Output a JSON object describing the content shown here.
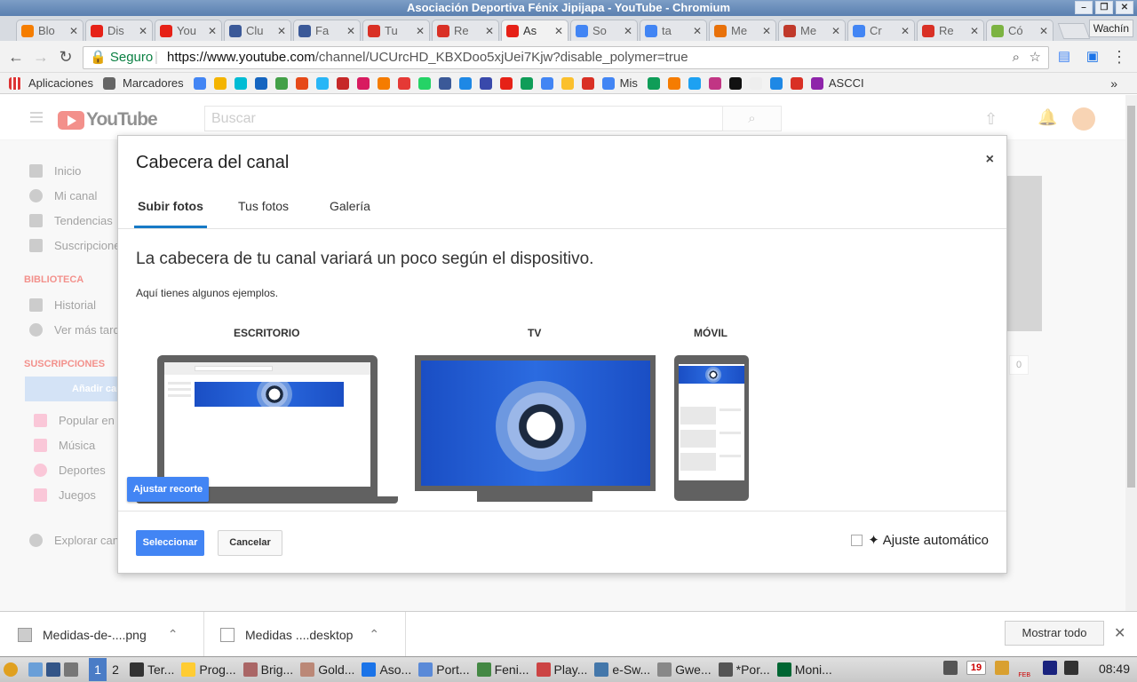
{
  "window": {
    "title": "Asociación Deportiva Fénix Jipijapa - YouTube - Chromium",
    "profile": "Wachín"
  },
  "tabs": [
    {
      "label": "Blo",
      "icon": "blogger-icon",
      "color": "#f57d00"
    },
    {
      "label": "Dis",
      "icon": "youtube-icon",
      "color": "#e62117"
    },
    {
      "label": "You",
      "icon": "youtube-icon",
      "color": "#e62117"
    },
    {
      "label": "Clu",
      "icon": "facebook-icon",
      "color": "#3b5998"
    },
    {
      "label": "Fa",
      "icon": "facebook-icon",
      "color": "#3b5998"
    },
    {
      "label": "Tu",
      "icon": "gmail-icon",
      "color": "#d93025"
    },
    {
      "label": "Re",
      "icon": "gmail-icon",
      "color": "#d93025"
    },
    {
      "label": "As",
      "icon": "youtube-icon",
      "color": "#e62117",
      "active": true
    },
    {
      "label": "So",
      "icon": "google-icon",
      "color": "#4285f4"
    },
    {
      "label": "ta",
      "icon": "google-icon",
      "color": "#4285f4"
    },
    {
      "label": "Me",
      "icon": "web-icon",
      "color": "#e8710a"
    },
    {
      "label": "Me",
      "icon": "web-icon",
      "color": "#c0392b"
    },
    {
      "label": "Cr",
      "icon": "google-icon",
      "color": "#4285f4"
    },
    {
      "label": "Re",
      "icon": "gmail-icon",
      "color": "#d93025"
    },
    {
      "label": "Có",
      "icon": "web-icon",
      "color": "#7cb342"
    }
  ],
  "toolbar": {
    "secure": "Seguro",
    "url_host": "https://www.youtube.com",
    "url_path": "/channel/UCUrcHD_KBXDoo5xjUei7Kjw?disable_polymer=true"
  },
  "bookmarks": {
    "apps": "Aplicaciones",
    "folder": "Marcadores",
    "mis": "Mis",
    "ascci": "ASCCI",
    "more": "»"
  },
  "youtube": {
    "logo": "YouTube",
    "search_placeholder": "Buscar",
    "guide": {
      "inicio": "Inicio",
      "mi_canal": "Mi canal",
      "tendencias": "Tendencias",
      "suscripciones": "Suscripcione",
      "biblioteca": "BIBLIOTECA",
      "historial": "Historial",
      "ver_mas": "Ver más tarde",
      "suscripciones_head": "SUSCRIPCIONES",
      "anadir": "Añadir can",
      "popular": "Popular en",
      "musica": "Música",
      "deportes": "Deportes",
      "juegos": "Juegos",
      "explorar": "Explorar can"
    },
    "sub_count": "0"
  },
  "dialog": {
    "title": "Cabecera del canal",
    "close": "×",
    "tabs": [
      "Subir fotos",
      "Tus fotos",
      "Galería"
    ],
    "headline": "La cabecera de tu canal variará un poco según el dispositivo.",
    "sub": "Aquí tienes algunos ejemplos.",
    "devices": {
      "desktop": "ESCRITORIO",
      "tv": "TV",
      "mobile": "MÓVIL"
    },
    "adjust": "Ajustar recorte",
    "select": "Seleccionar",
    "cancel": "Cancelar",
    "auto": "Ajuste automático"
  },
  "downloads": {
    "file1": "Medidas-de-....png",
    "file2": "Medidas ....desktop",
    "show_all": "Mostrar todo"
  },
  "taskbar": {
    "ws1": "1",
    "ws2": "2",
    "items": [
      "Ter...",
      "Prog...",
      "Brig...",
      "Gold...",
      "Aso...",
      "Port...",
      "Feni...",
      "Play...",
      "e-Sw...",
      "Gwe...",
      "*Por...",
      "Moni..."
    ],
    "date_day": "19",
    "date_month": "FEB",
    "clock": "08:49"
  }
}
